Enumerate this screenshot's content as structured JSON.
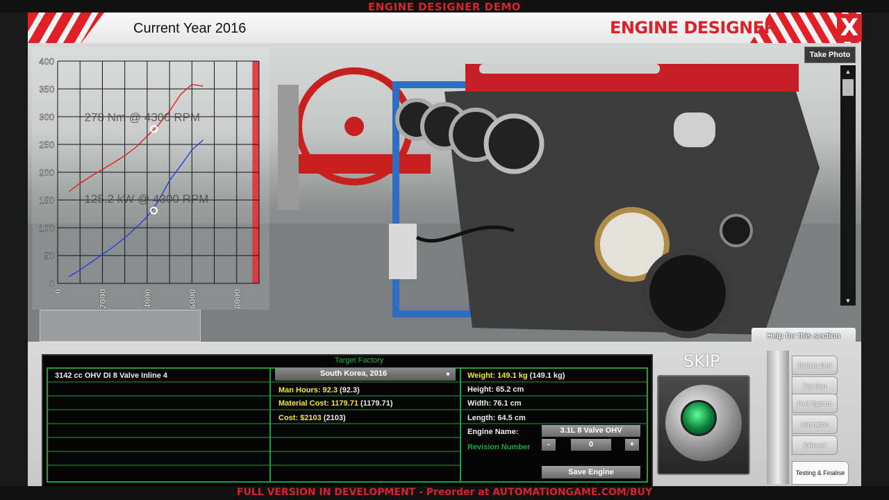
{
  "app": {
    "demo_banner": "ENGINE DESIGNER DEMO",
    "current_year": "Current Year 2016",
    "title": "ENGINE DESIGNER",
    "close_label": "X",
    "bottom_banner": "FULL VERSION IN DEVELOPMENT - Preorder at AUTOMATIONGAME.COM/BUY"
  },
  "viewport": {
    "take_photo_label": "Take Photo",
    "help_label": "Help for this section",
    "scroll_up_icon": "triangle-up-icon",
    "scroll_down_icon": "triangle-down-icon"
  },
  "chart_data": {
    "type": "line",
    "xlabel": "",
    "ylabel": "",
    "xlim": [
      0,
      9000
    ],
    "ylim": [
      0,
      400
    ],
    "x_ticks": [
      0,
      2000,
      4000,
      6000,
      8000
    ],
    "y_ticks": [
      0,
      50,
      100,
      150,
      200,
      250,
      300,
      350,
      400
    ],
    "series": [
      {
        "color": "#e02020",
        "x": [
          500,
          1000,
          1500,
          2000,
          2500,
          3000,
          3500,
          4000,
          4500,
          5000,
          5500,
          6000,
          6500
        ],
        "y": [
          165,
          180,
          193,
          205,
          217,
          230,
          245,
          265,
          285,
          310,
          340,
          358,
          355
        ]
      },
      {
        "color": "#2040e0",
        "x": [
          500,
          1000,
          1500,
          2000,
          2500,
          3000,
          3500,
          4000,
          4500,
          5000,
          5500,
          6000,
          6500
        ],
        "y": [
          12,
          24,
          38,
          52,
          66,
          82,
          100,
          120,
          148,
          185,
          212,
          240,
          258
        ]
      }
    ],
    "annotations": [
      {
        "text": "278 Nm @ 4300 RPM",
        "x": 4300,
        "y": 278
      },
      {
        "text": "125.2 kW @ 4300 RPM",
        "x": 4300,
        "y": 131
      }
    ],
    "redline_start": 8700,
    "redline_color": "#e0333a"
  },
  "details": {
    "target_factory_label": "Target Factory",
    "engine_desc": "3142 cc OHV DI 8 Valve Inline 4",
    "factory_value": "South Korea, 2016",
    "man_hours_label": "Man Hours: 92.3",
    "man_hours_base": "(92.3)",
    "material_cost_label": "Material Cost: 1179.71",
    "material_cost_base": "(1179.71)",
    "cost_label": "Cost: $2103",
    "cost_base": "(2103)",
    "weight_label": "Weight: 149.1 kg",
    "weight_base": "(149.1 kg)",
    "height": "Height: 65.2 cm",
    "width": "Width: 76.1 cm",
    "length": "Length: 64.5 cm",
    "engine_name_label": "Engine Name:",
    "engine_name_value": "3.1L 8 Valve OHV",
    "revision_label": "Revision Number",
    "revision_minus": "-",
    "revision_value": "0",
    "revision_plus": "+",
    "save_label": "Save Engine"
  },
  "skip_label": "SKIP",
  "nav_tabs": [
    {
      "label": "Bottom End"
    },
    {
      "label": "Top End"
    },
    {
      "label": "Fuel System"
    },
    {
      "label": "Aspiration"
    },
    {
      "label": "Exhaust"
    },
    {
      "label": "Testing & Finalise"
    }
  ],
  "colors": {
    "accent_red": "#d8232a",
    "table_green": "#1aa53a",
    "highlight_yellow": "#f2e93a"
  }
}
